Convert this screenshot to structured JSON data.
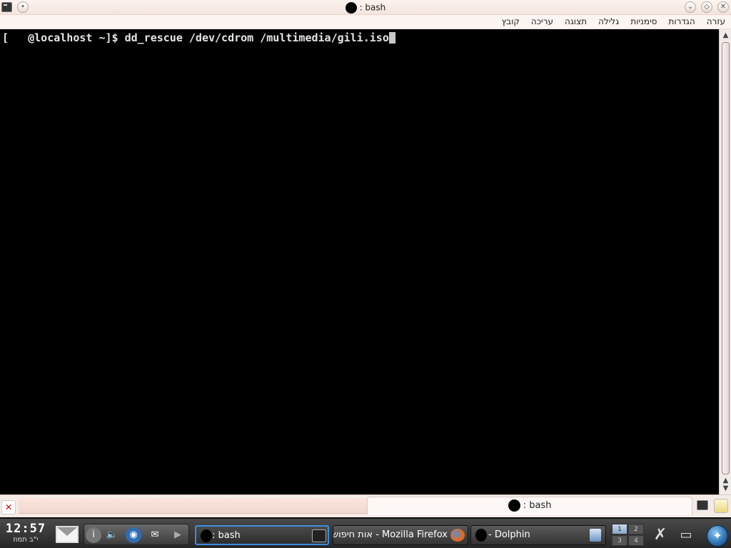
{
  "window": {
    "title": ": bash",
    "menu": [
      "קובץ",
      "עריכה",
      "תצוגה",
      "גלילה",
      "סימניות",
      "הגדרות",
      "עזרה"
    ]
  },
  "terminal": {
    "prompt": "[   @localhost ~]$ ",
    "command": "dd_rescue /dev/cdrom /multimedia/gili.iso"
  },
  "tabs": {
    "active_label": ": bash"
  },
  "taskbar": {
    "clock_time": "12:57",
    "clock_date": "י\"ב תמוז",
    "tasks": [
      {
        "label": ": bash",
        "icon": "terminal-icon",
        "active": true
      },
      {
        "label": "אות חיפוש - Mozilla Firefox",
        "icon": "firefox-icon",
        "active": false
      },
      {
        "label": "- Dolphin",
        "icon": "dolphin-icon",
        "active": false
      }
    ],
    "pager": [
      "1",
      "2",
      "3",
      "4"
    ],
    "current_desktop": "1"
  },
  "colors": {
    "terminal_bg": "#000000",
    "terminal_fg": "#e6e6e6",
    "titlebar_bg": "#fdf3ee",
    "taskbar_bg": "#333333",
    "active_task_border": "#3b8ee0"
  }
}
